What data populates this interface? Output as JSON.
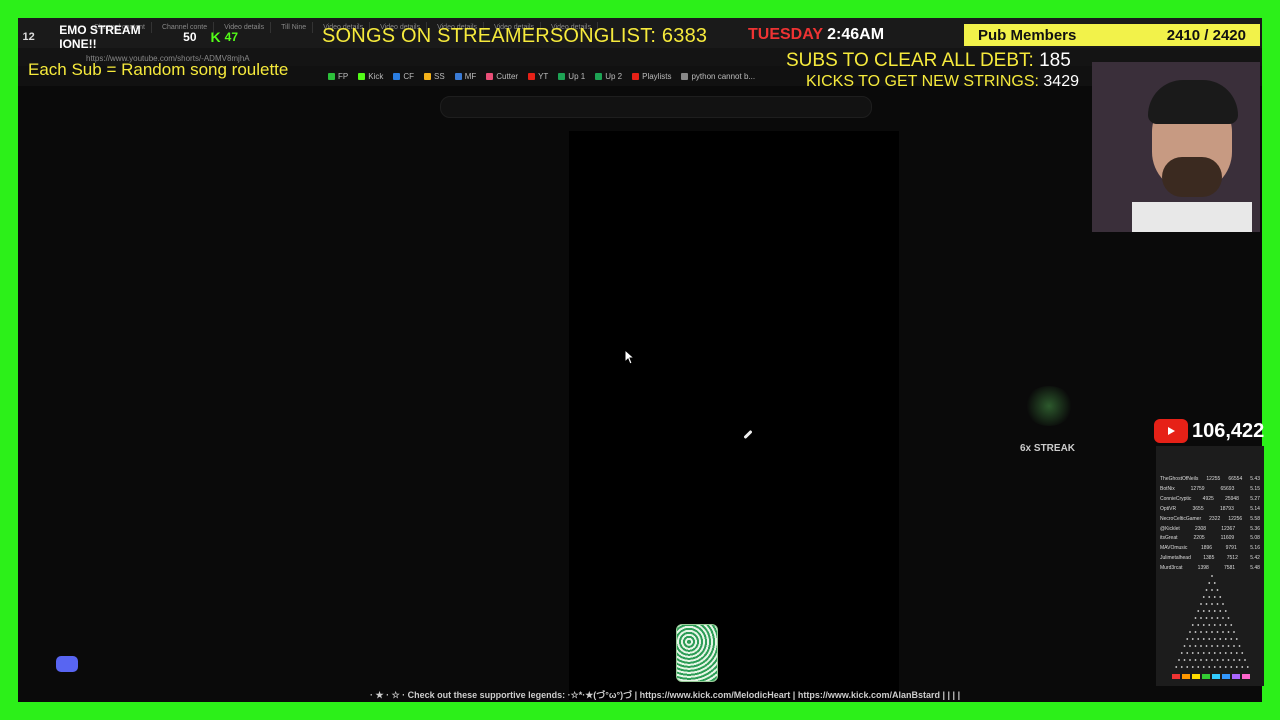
{
  "browser": {
    "url": "https://www.youtube.com/shorts/-ADMV8mjhA",
    "tabs": [
      "Channel content",
      "Channel conte",
      "Video details",
      "Till Nine",
      "Video details",
      "Video details",
      "Video details",
      "Video details",
      "Video details"
    ],
    "bookmarks": [
      {
        "label": "FP",
        "color": "#2cc03a"
      },
      {
        "label": "Kick",
        "color": "#53fc18"
      },
      {
        "label": "CF",
        "color": "#2a7de1"
      },
      {
        "label": "SS",
        "color": "#f3b21a"
      },
      {
        "label": "MF",
        "color": "#3a7bd5"
      },
      {
        "label": "Cutter",
        "color": "#e94e77"
      },
      {
        "label": "YT",
        "color": "#e62117"
      },
      {
        "label": "Up 1",
        "color": "#1da354"
      },
      {
        "label": "Up 2",
        "color": "#1da354"
      },
      {
        "label": "Playlists",
        "color": "#e62117"
      },
      {
        "label": "python cannot b...",
        "color": "#888888"
      }
    ]
  },
  "overlay": {
    "counter_left": "12",
    "emo_label": "EMO STREAM IONE!!",
    "counter_right": "50",
    "kick_count": "47",
    "songs_label": "SONGS ON STREAMERSONGLIST:",
    "songs_value": "6383",
    "day": "TUESDAY",
    "time": "2:46AM",
    "pub_label": "Pub Members",
    "pub_value": "2410 / 2420",
    "subs_label": "SUBS TO CLEAR ALL DEBT:",
    "subs_value": "185",
    "kicks_label": "KICKS TO GET NEW STRINGS:",
    "kicks_value": "3429",
    "roulette": "Each Sub = Random song roulette",
    "youtube_count": "106,422",
    "streak": "6x STREAK",
    "ticker": "· ★ · ☆ · Check out these supportive legends: ·☆*·★(づ°ω°)づ | https://www.kick.com/MelodicHeart | https://www.kick.com/AlanBstard | | | |"
  },
  "leaderboard": [
    {
      "name": "TheGhostOfNeils",
      "a": "12255",
      "b": "66554",
      "c": "5.43"
    },
    {
      "name": "BotNix",
      "a": "12759",
      "b": "65693",
      "c": "5.15"
    },
    {
      "name": "ConnieCryptic",
      "a": "4925",
      "b": "25948",
      "c": "5.27"
    },
    {
      "name": "OptiVR",
      "a": "3655",
      "b": "18793",
      "c": "5.14"
    },
    {
      "name": "NecroCelticGamer",
      "a": "2322",
      "b": "12256",
      "c": "5.58"
    },
    {
      "name": "@Kicklet",
      "a": "2308",
      "b": "12367",
      "c": "5.36"
    },
    {
      "name": "itsGreat",
      "a": "2205",
      "b": "11609",
      "c": "5.08"
    },
    {
      "name": "MAVOmusic",
      "a": "1896",
      "b": "9791",
      "c": "5.16"
    },
    {
      "name": "Julimetalhead",
      "a": "1385",
      "b": "7512",
      "c": "5.42"
    },
    {
      "name": "Murd3rcat",
      "a": "1398",
      "b": "7581",
      "c": "5.48"
    }
  ],
  "colors": {
    "frame": "#2cf019",
    "accent_yellow": "#f6ea3c",
    "youtube_red": "#e62117",
    "pub_bg": "#f2f24a"
  }
}
